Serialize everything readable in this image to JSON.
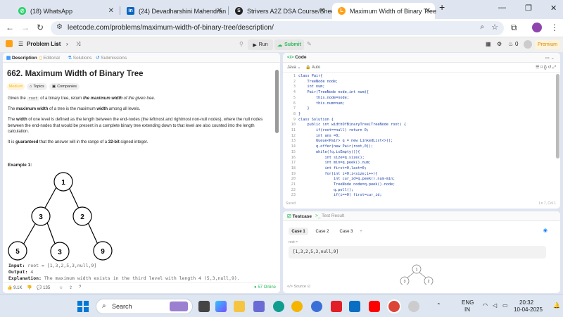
{
  "browser": {
    "tabs": [
      {
        "title": "(18) WhatsApp",
        "icon": "whatsapp-icon",
        "color": "#25d366"
      },
      {
        "title": "(24) Devadharshini Mahendran",
        "icon": "linkedin-icon",
        "color": "#0a66c2"
      },
      {
        "title": "Strivers A2Z DSA Course/Sheet",
        "icon": "striver-icon",
        "color": "#222222"
      },
      {
        "title": "Maximum Width of Binary Tree",
        "icon": "leetcode-icon",
        "color": "#ffa116"
      }
    ],
    "url": "leetcode.com/problems/maximum-width-of-binary-tree/description/"
  },
  "header": {
    "problem_list": "Problem List",
    "run": "Run",
    "submit": "Submit",
    "fire_count": "0",
    "premium": "Premium"
  },
  "left": {
    "tabs": [
      "Description",
      "Editorial",
      "Solutions",
      "Submissions"
    ],
    "title": "662. Maximum Width of Binary Tree",
    "difficulty": "Medium",
    "topics": "Topics",
    "companies": "Companies",
    "p1_a": "Given the ",
    "p1_code": "root",
    "p1_b": " of a binary tree, return ",
    "p1_c": "the maximum width",
    "p1_d": " of the given tree.",
    "p2_a": "The ",
    "p2_b": "maximum width",
    "p2_c": " of a tree is the maximum ",
    "p2_d": "width",
    "p2_e": " among all levels.",
    "p3_a": "The ",
    "p3_b": "width",
    "p3_c": " of one level is defined as the length between the end-nodes (the leftmost and rightmost non-null nodes), where the null nodes between the end-nodes that would be present in a complete binary tree extending down to that level are also counted into the length calculation.",
    "p4_a": "It is ",
    "p4_b": "guaranteed",
    "p4_c": " that the answer will in the range of a ",
    "p4_d": "32-bit",
    "p4_e": " signed integer.",
    "example_label": "Example 1:",
    "tree_nodes": [
      "1",
      "3",
      "2",
      "5",
      "3",
      "9"
    ],
    "input_label": "Input:",
    "input_value": "root = [1,3,2,5,3,null,9]",
    "output_label": "Output:",
    "output_value": "4",
    "expl_label": "Explanation:",
    "expl_value": "The maximum width exists in the third level with length 4 (5,3,null,9).",
    "likes": "9.1K",
    "comments": "135",
    "online": "57 Online"
  },
  "code": {
    "tab": "Code",
    "language": "Java",
    "auto": "Auto",
    "lines": [
      "class Pair{",
      "    TreeNode node;",
      "    int num;",
      "    Pair(TreeNode node,int num){",
      "        this.node=node;",
      "        this.num=num;",
      "    }",
      "}",
      "class Solution {",
      "    public int widthOfBinaryTree(TreeNode root) {",
      "        if(root==null) return 0;",
      "        int ans =0;",
      "        Queue<Pair> q = new LinkedList<>();",
      "        q.offer(new Pair(root,0));",
      "        while(!q.isEmpty()){",
      "            int size=q.size();",
      "            int min=q.peek().num;",
      "            int first=0,last=0;",
      "            for(int i=0;i<size;i++){",
      "                int cur_id=q.peek().num-min;",
      "                TreeNode node=q.peek().node;",
      "                q.poll();",
      "                if(i==0) first=cur_id;"
    ],
    "saved": "Saved",
    "position": "Ln 7, Col 1"
  },
  "testcase": {
    "tab": "Testcase",
    "result_tab": "Test Result",
    "cases": [
      "Case 1",
      "Case 2",
      "Case 3"
    ],
    "add": "+",
    "input_label": "root =",
    "input_value": "[1,3,2,5,3,null,9]",
    "preview_nodes": [
      "1",
      "3",
      "2"
    ],
    "source": "Source"
  },
  "taskbar": {
    "search": "Search",
    "lang1": "ENG",
    "lang2": "IN",
    "time": "20:32",
    "date": "10-04-2025"
  }
}
